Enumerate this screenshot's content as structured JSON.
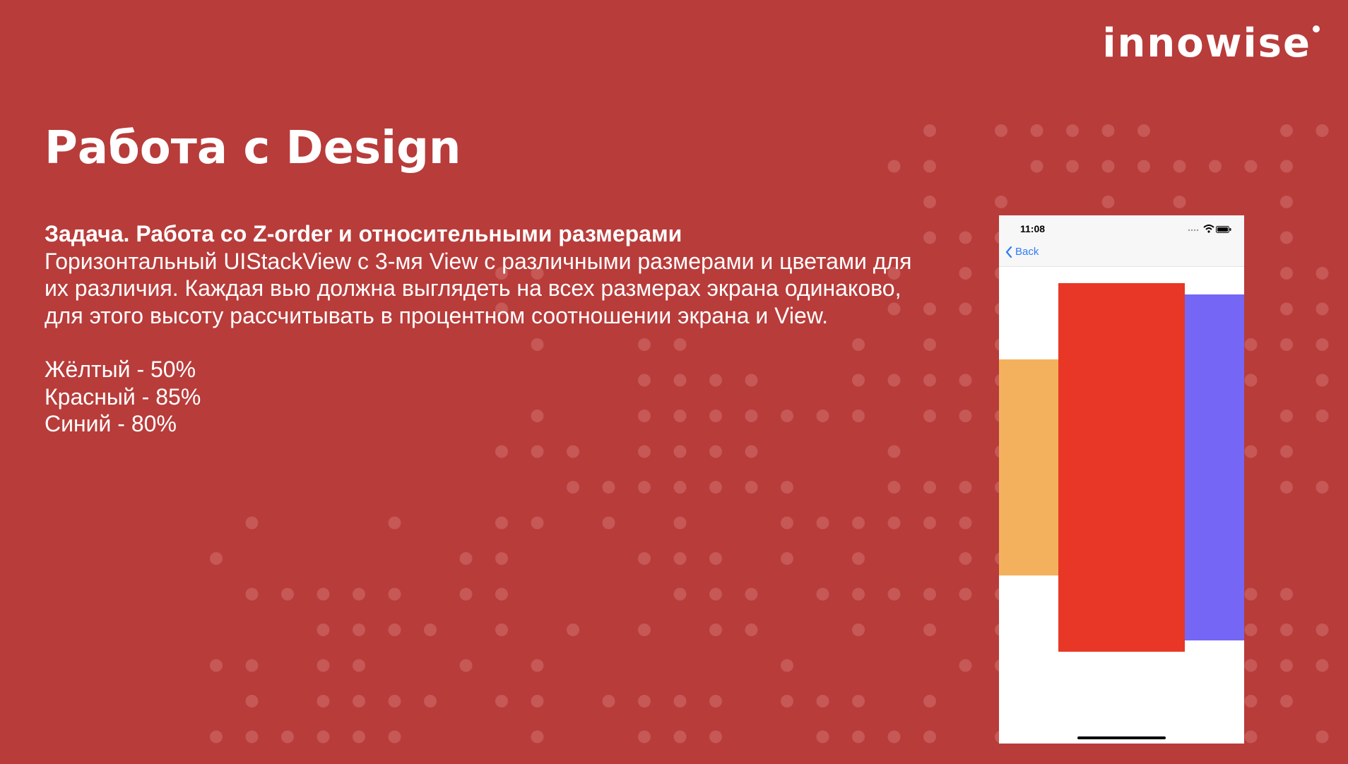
{
  "brand": {
    "logo_text": "innowise"
  },
  "slide": {
    "title": "Работа с Design",
    "task_heading": "Задача. Работа со Z-order и относительными размерами",
    "task_description": "Горизонтальный  UIStackView с 3-мя View с различными размерами и цветами для их различия. Каждая вью должна выглядеть на всех размерах экрана одинаково, для этого высоту рассчитывать в процентном соотношении экрана и View.",
    "levels": [
      "Жёлтый - 50%",
      "Красный - 85%",
      "Синий - 80%"
    ]
  },
  "phone": {
    "status_time": "11:08",
    "back_label": "Back",
    "icons": [
      "signal-icon",
      "wifi-icon",
      "battery-icon",
      "chevron-left-icon"
    ],
    "views": [
      {
        "name": "yellow-view",
        "color": "#f4b15d",
        "height_fraction": 0.5
      },
      {
        "name": "red-view",
        "color": "#e83726",
        "height_fraction": 0.85
      },
      {
        "name": "blue-view",
        "color": "#7566f6",
        "height_fraction": 0.8
      }
    ],
    "background_color": "#ffffff",
    "accent_color": "#2f7cf6"
  },
  "colors": {
    "background": "#b83c3a",
    "dots": "#c65856"
  }
}
